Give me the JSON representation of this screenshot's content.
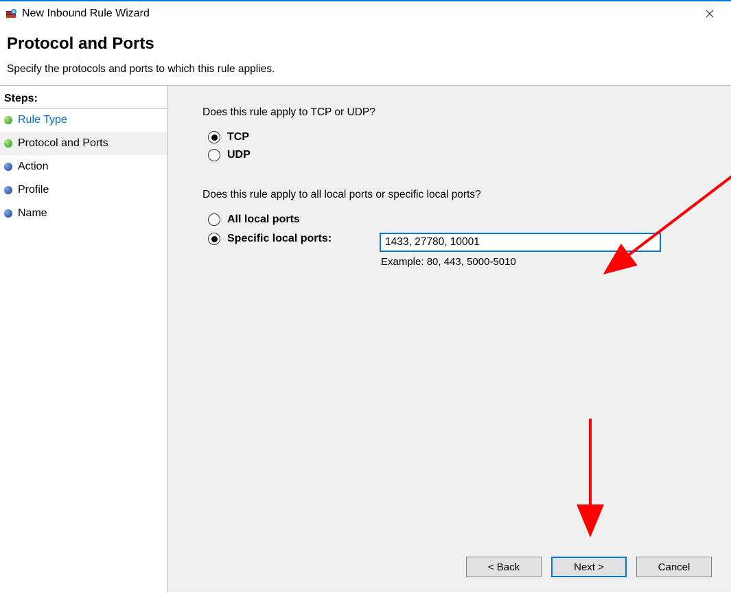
{
  "window": {
    "title": "New Inbound Rule Wizard"
  },
  "header": {
    "title": "Protocol and Ports",
    "subtitle": "Specify the protocols and ports to which this rule applies."
  },
  "sidebar": {
    "header": "Steps:",
    "items": [
      {
        "label": "Rule Type",
        "link": true,
        "bullet": "green",
        "selected": false
      },
      {
        "label": "Protocol and Ports",
        "link": false,
        "bullet": "green",
        "selected": true
      },
      {
        "label": "Action",
        "link": false,
        "bullet": "blue",
        "selected": false
      },
      {
        "label": "Profile",
        "link": false,
        "bullet": "blue",
        "selected": false
      },
      {
        "label": "Name",
        "link": false,
        "bullet": "blue",
        "selected": false
      }
    ]
  },
  "main": {
    "question1": "Does this rule apply to TCP or UDP?",
    "protocol": {
      "tcp": "TCP",
      "udp": "UDP",
      "selected": "tcp"
    },
    "question2": "Does this rule apply to all local ports or specific local ports?",
    "ports": {
      "all": "All local ports",
      "specific": "Specific local ports:",
      "selected": "specific",
      "value": "1433, 27780, 10001",
      "example": "Example: 80, 443, 5000-5010"
    }
  },
  "buttons": {
    "back": "< Back",
    "next": "Next >",
    "cancel": "Cancel"
  }
}
